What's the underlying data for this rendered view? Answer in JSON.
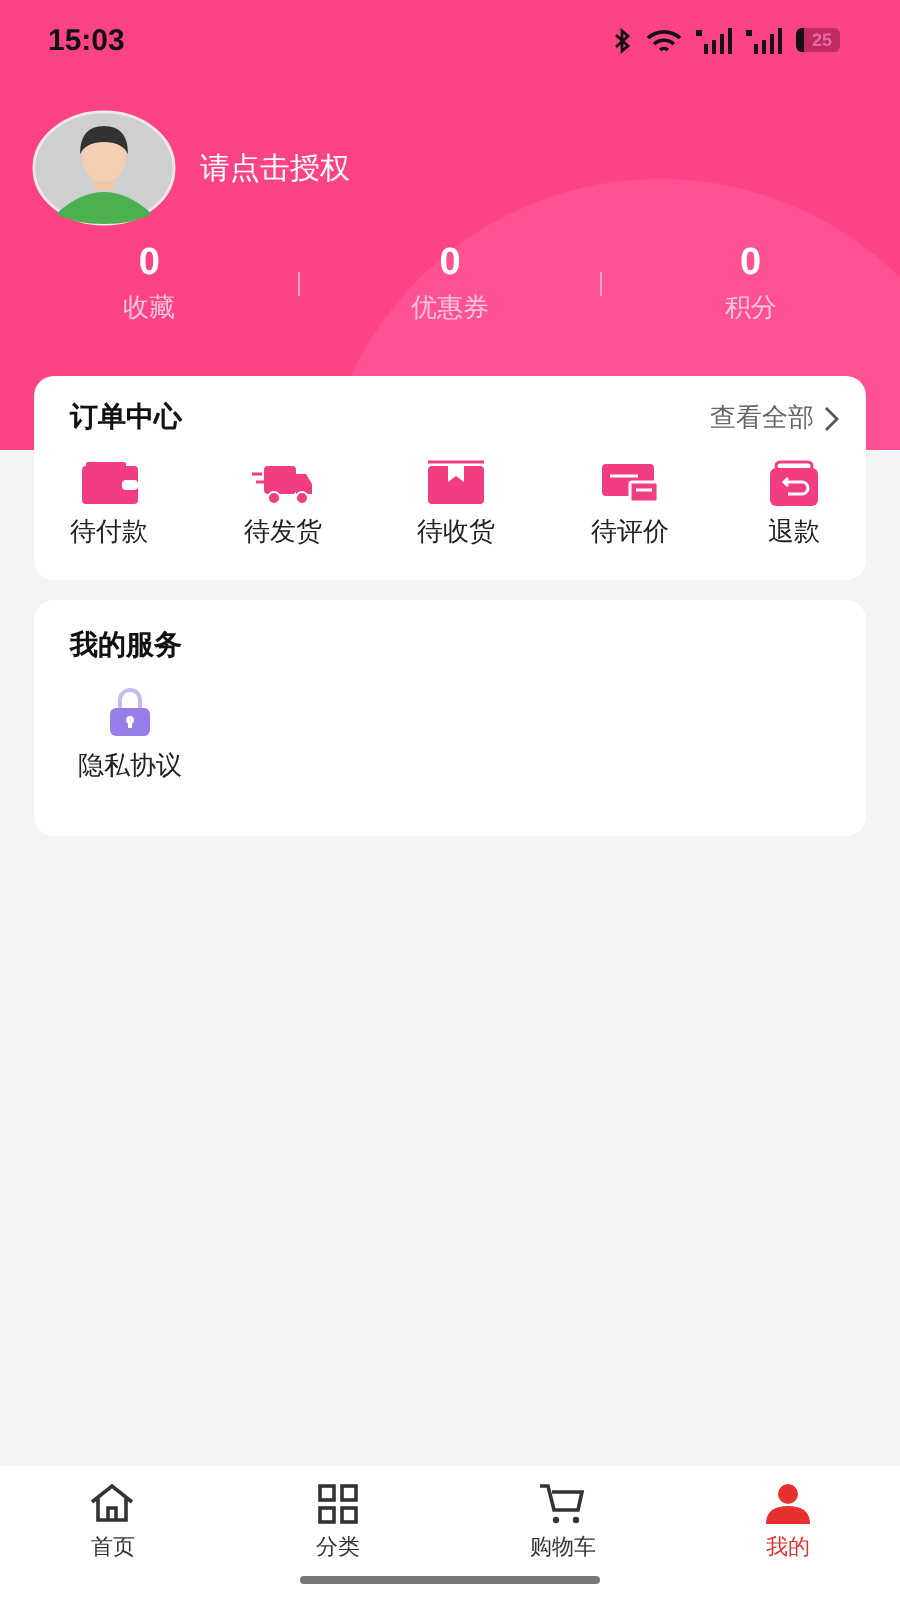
{
  "status_bar": {
    "time": "15:03",
    "battery": "25"
  },
  "profile": {
    "prompt": "请点击授权"
  },
  "stats": [
    {
      "value": "0",
      "label": "收藏"
    },
    {
      "value": "0",
      "label": "优惠券"
    },
    {
      "value": "0",
      "label": "积分"
    }
  ],
  "orders": {
    "title": "订单中心",
    "view_all": "查看全部",
    "items": [
      {
        "kind": "wallet",
        "label": "待付款"
      },
      {
        "kind": "truck",
        "label": "待发货"
      },
      {
        "kind": "box",
        "label": "待收货"
      },
      {
        "kind": "comment",
        "label": "待评价"
      },
      {
        "kind": "refund",
        "label": "退款"
      }
    ]
  },
  "services": {
    "title": "我的服务",
    "items": [
      {
        "kind": "lock",
        "label": "隐私协议"
      }
    ]
  },
  "tab_bar": [
    {
      "kind": "home",
      "label": "首页",
      "selected": false
    },
    {
      "kind": "grid",
      "label": "分类",
      "selected": false
    },
    {
      "kind": "cart",
      "label": "购物车",
      "selected": false
    },
    {
      "kind": "user",
      "label": "我的",
      "selected": true
    }
  ]
}
